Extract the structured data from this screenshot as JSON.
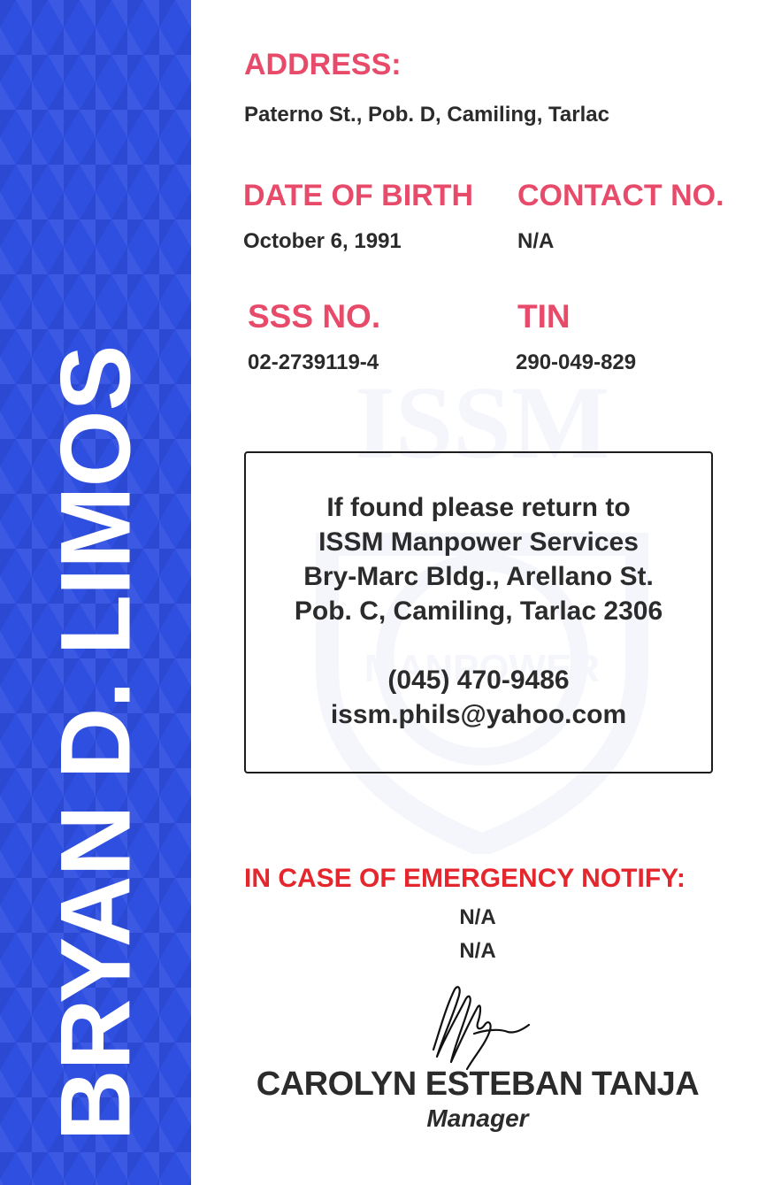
{
  "holder": {
    "name": "BRYAN D. LIMOS"
  },
  "watermark": {
    "text": "ISSM",
    "subtext": "MANPOWER"
  },
  "address": {
    "label": "ADDRESS:",
    "value": "Paterno St., Pob. D, Camiling, Tarlac"
  },
  "date_of_birth": {
    "label": "DATE OF BIRTH",
    "value": "October 6, 1991"
  },
  "contact": {
    "label": "CONTACT NO.",
    "value": "N/A"
  },
  "sss": {
    "label": "SSS NO.",
    "value": "02-2739119-4"
  },
  "tin": {
    "label": "TIN",
    "value": "290-049-829"
  },
  "return_notice": {
    "line1": "If found please return to",
    "line2": "ISSM Manpower Services",
    "line3": "Bry-Marc Bldg., Arellano St.",
    "line4": "Pob. C, Camiling, Tarlac 2306",
    "phone": "(045) 470-9486",
    "email": "issm.phils@yahoo.com"
  },
  "emergency": {
    "label": "IN CASE OF EMERGENCY NOTIFY:",
    "name": "N/A",
    "contact": "N/A"
  },
  "signatory": {
    "name": "CAROLYN ESTEBAN TANJA",
    "title": "Manager"
  },
  "colors": {
    "sidebar": "#2f4fe0",
    "label": "#e84a6a",
    "emergency": "#e5262d",
    "text": "#2b2b2b"
  }
}
